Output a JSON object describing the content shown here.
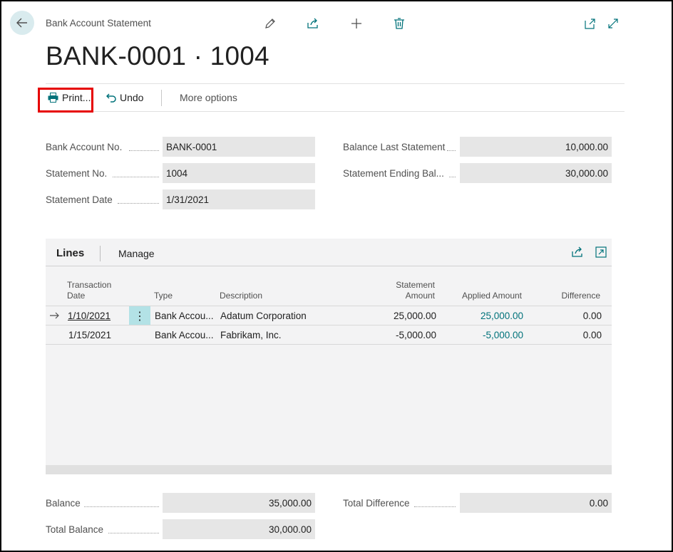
{
  "header": {
    "breadcrumb": "Bank Account Statement",
    "title": "BANK-0001 · 1004"
  },
  "actions": {
    "print_label": "Print...",
    "undo_label": "Undo",
    "more_label": "More options"
  },
  "fields": {
    "bank_account_no": {
      "label": "Bank Account No.",
      "value": "BANK-0001"
    },
    "statement_no": {
      "label": "Statement No.",
      "value": "1004"
    },
    "statement_date": {
      "label": "Statement Date",
      "value": "1/31/2021"
    },
    "balance_last_statement": {
      "label": "Balance Last Statement",
      "value": "10,000.00"
    },
    "statement_ending_bal": {
      "label": "Statement Ending Bal...",
      "value": "30,000.00"
    }
  },
  "lines": {
    "title": "Lines",
    "manage_label": "Manage",
    "columns": {
      "transaction_date_1": "Transaction",
      "transaction_date_2": "Date",
      "type": "Type",
      "description": "Description",
      "statement_amount_1": "Statement",
      "statement_amount_2": "Amount",
      "applied_amount": "Applied Amount",
      "difference": "Difference"
    },
    "rows": [
      {
        "date": "1/10/2021",
        "type": "Bank Accou...",
        "description": "Adatum Corporation",
        "statement_amount": "25,000.00",
        "applied_amount": "25,000.00",
        "difference": "0.00"
      },
      {
        "date": "1/15/2021",
        "type": "Bank Accou...",
        "description": "Fabrikam, Inc.",
        "statement_amount": "-5,000.00",
        "applied_amount": "-5,000.00",
        "difference": "0.00"
      }
    ]
  },
  "totals": {
    "balance": {
      "label": "Balance",
      "value": "35,000.00"
    },
    "total_balance": {
      "label": "Total Balance",
      "value": "30,000.00"
    },
    "total_difference": {
      "label": "Total Difference",
      "value": "0.00"
    }
  },
  "colors": {
    "accent": "#00727a",
    "highlight": "#e60000",
    "field_bg": "#e6e6e6"
  },
  "icons": [
    "back-arrow-icon",
    "edit-pencil-icon",
    "share-icon",
    "add-plus-icon",
    "delete-trash-icon",
    "open-new-window-icon",
    "expand-icon",
    "printer-icon",
    "undo-icon",
    "row-arrow-icon",
    "row-menu-icon"
  ]
}
